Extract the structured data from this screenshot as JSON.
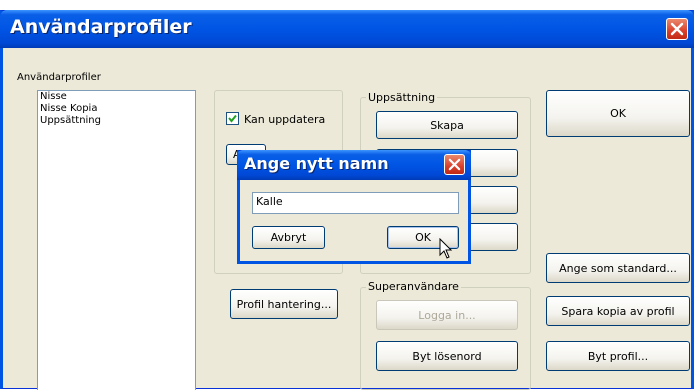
{
  "window": {
    "title": "Användarprofiler"
  },
  "profiles": {
    "label": "Användarprofiler",
    "items": [
      "Nisse",
      "Nisse Kopia",
      "Uppsättning"
    ]
  },
  "options": {
    "can_update_label": "Kan uppdatera",
    "can_update_checked": true,
    "hidden_button_prefix": "A",
    "profile_management_label": "Profil hantering..."
  },
  "setup": {
    "label": "Uppsättning",
    "create_label": "Skapa"
  },
  "superuser": {
    "label": "Superanvändare",
    "login_label": "Logga in...",
    "change_password_label": "Byt lösenord"
  },
  "actions": {
    "ok_label": "OK",
    "set_default_label": "Ange som standard...",
    "save_copy_label": "Spara kopia av profil",
    "change_profile_label": "Byt profil..."
  },
  "dialog": {
    "title": "Ange nytt namn",
    "name_value": "Kalle",
    "cancel_label": "Avbryt",
    "ok_label": "OK"
  }
}
